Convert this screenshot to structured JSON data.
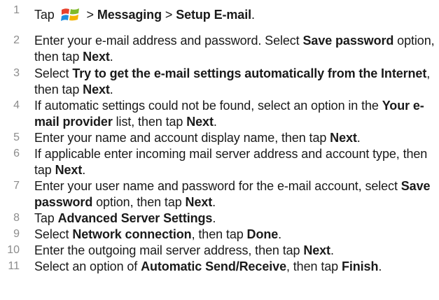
{
  "steps": [
    {
      "number": "1",
      "parts": [
        {
          "text": "Tap ",
          "bold": false
        },
        {
          "icon": "windows-start-icon"
        },
        {
          "text": " > ",
          "bold": false
        },
        {
          "text": "Messaging",
          "bold": true
        },
        {
          "text": " > ",
          "bold": false
        },
        {
          "text": "Setup E-mail",
          "bold": true
        },
        {
          "text": ".",
          "bold": false
        }
      ]
    },
    {
      "number": "2",
      "parts": [
        {
          "text": "Enter your e-mail address and password. Select ",
          "bold": false
        },
        {
          "text": "Save password",
          "bold": true
        },
        {
          "text": " option, then tap ",
          "bold": false
        },
        {
          "text": "Next",
          "bold": true
        },
        {
          "text": ".",
          "bold": false
        }
      ]
    },
    {
      "number": "3",
      "parts": [
        {
          "text": "Select ",
          "bold": false
        },
        {
          "text": "Try to get the e-mail settings automatically from the Internet",
          "bold": true
        },
        {
          "text": ", then tap ",
          "bold": false
        },
        {
          "text": "Next",
          "bold": true
        },
        {
          "text": ".",
          "bold": false
        }
      ]
    },
    {
      "number": "4",
      "parts": [
        {
          "text": "If automatic settings could not be found, select an option in the ",
          "bold": false
        },
        {
          "text": "Your e-mail provider",
          "bold": true
        },
        {
          "text": " list, then tap ",
          "bold": false
        },
        {
          "text": "Next",
          "bold": true
        },
        {
          "text": ".",
          "bold": false
        }
      ]
    },
    {
      "number": "5",
      "parts": [
        {
          "text": "Enter your name and account display name, then tap ",
          "bold": false
        },
        {
          "text": "Next",
          "bold": true
        },
        {
          "text": ".",
          "bold": false
        }
      ]
    },
    {
      "number": "6",
      "parts": [
        {
          "text": "If applicable enter incoming mail server address and account type, then tap ",
          "bold": false
        },
        {
          "text": "Next",
          "bold": true
        },
        {
          "text": ".",
          "bold": false
        }
      ]
    },
    {
      "number": "7",
      "parts": [
        {
          "text": "Enter your user name and password for the e-mail account, select ",
          "bold": false
        },
        {
          "text": "Save password",
          "bold": true
        },
        {
          "text": " option, then tap ",
          "bold": false
        },
        {
          "text": "Next",
          "bold": true
        },
        {
          "text": ".",
          "bold": false
        }
      ]
    },
    {
      "number": "8",
      "parts": [
        {
          "text": "Tap ",
          "bold": false
        },
        {
          "text": "Advanced Server Settings",
          "bold": true
        },
        {
          "text": ".",
          "bold": false
        }
      ]
    },
    {
      "number": "9",
      "parts": [
        {
          "text": "Select ",
          "bold": false
        },
        {
          "text": "Network connection",
          "bold": true
        },
        {
          "text": ", then tap ",
          "bold": false
        },
        {
          "text": "Done",
          "bold": true
        },
        {
          "text": ".",
          "bold": false
        }
      ]
    },
    {
      "number": "10",
      "parts": [
        {
          "text": "Enter the outgoing mail server address, then tap ",
          "bold": false
        },
        {
          "text": "Next",
          "bold": true
        },
        {
          "text": ".",
          "bold": false
        }
      ]
    },
    {
      "number": "11",
      "parts": [
        {
          "text": "Select an option of ",
          "bold": false
        },
        {
          "text": "Automatic Send/Receive",
          "bold": true
        },
        {
          "text": ", then tap ",
          "bold": false
        },
        {
          "text": "Finish",
          "bold": true
        },
        {
          "text": ".",
          "bold": false
        }
      ]
    }
  ]
}
